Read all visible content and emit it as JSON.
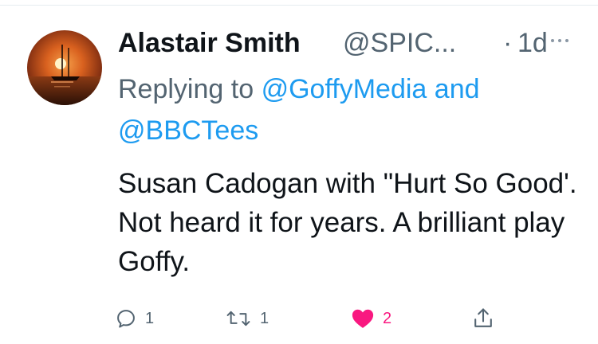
{
  "tweet": {
    "author": {
      "display_name": "Alastair Smith",
      "handle": "@SPIC...",
      "avatar_description": "sunset-sailboat-avatar"
    },
    "separator": "·",
    "timestamp": "1d",
    "replying_to": {
      "prefix": "Replying to",
      "mention_1": "@GoffyMedia",
      "conjunction": "and",
      "mention_2": "@BBCTees"
    },
    "text": "Susan Cadogan with \"Hurt So Good'. Not heard it for years. A brilliant play Goffy.",
    "actions": {
      "reply_count": "1",
      "retweet_count": "1",
      "like_count": "2"
    }
  },
  "colors": {
    "text_primary": "#0f1419",
    "text_secondary": "#536471",
    "link": "#1d9bf0",
    "like": "#f91880"
  },
  "icons": {
    "reply": "reply-icon",
    "retweet": "retweet-icon",
    "like": "heart-icon",
    "share": "share-icon",
    "more": "more-icon"
  }
}
